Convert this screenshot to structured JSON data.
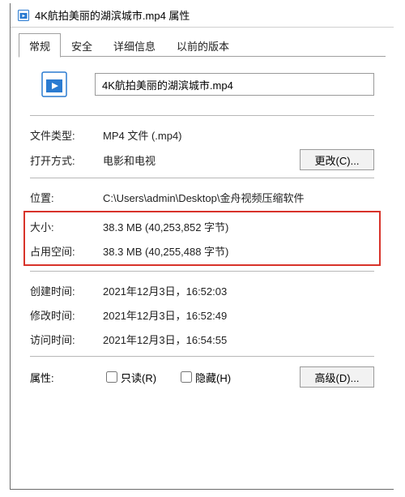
{
  "titlebar": {
    "title": "4K航拍美丽的湖滨城市.mp4 属性"
  },
  "tabs": {
    "general": "常规",
    "security": "安全",
    "details": "详细信息",
    "previous": "以前的版本"
  },
  "file": {
    "name": "4K航拍美丽的湖滨城市.mp4"
  },
  "labels": {
    "type": "文件类型:",
    "opens_with": "打开方式:",
    "location": "位置:",
    "size": "大小:",
    "size_on_disk": "占用空间:",
    "created": "创建时间:",
    "modified": "修改时间:",
    "accessed": "访问时间:",
    "attributes": "属性:"
  },
  "values": {
    "type": "MP4 文件 (.mp4)",
    "opens_with": "电影和电视",
    "location": "C:\\Users\\admin\\Desktop\\金舟视频压缩软件",
    "size": "38.3 MB (40,253,852 字节)",
    "size_on_disk": "38.3 MB (40,255,488 字节)",
    "created": "2021年12月3日，16:52:03",
    "modified": "2021年12月3日，16:52:49",
    "accessed": "2021年12月3日，16:54:55"
  },
  "buttons": {
    "change": "更改(C)...",
    "advanced": "高级(D)..."
  },
  "checkboxes": {
    "readonly": "只读(R)",
    "hidden": "隐藏(H)"
  }
}
